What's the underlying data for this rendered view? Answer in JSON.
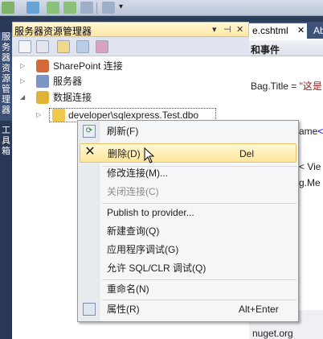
{
  "toolbar": {
    "overflow_glyph": "▾"
  },
  "left_strip": {
    "tab1": "服务器资源管理器",
    "tab2": "工具箱"
  },
  "panel": {
    "title": "服务器资源管理器",
    "pin_glyph": "▾",
    "autohide_glyph": "⊣",
    "close_glyph": "✕",
    "tree": [
      {
        "label": "SharePoint 连接",
        "icon": "sharepoint-icon"
      },
      {
        "label": "服务器",
        "icon": "server-icon"
      },
      {
        "label": "数据连接",
        "icon": "database-icon"
      },
      {
        "label": "developer\\sqlexpress.Test.dbo",
        "icon": "data-connection-icon"
      }
    ]
  },
  "editor": {
    "tab_active": "e.cshtml",
    "tab_close": "✕",
    "tab_next": "Ab",
    "header_text": "和事件",
    "code_lines": [
      {
        "pre": "Bag.Title = ",
        "str": "\"这是"
      },
      {
        "pre": "ame",
        "str": "<"
      },
      {
        "pre": "< Vie",
        "str": ""
      },
      {
        "pre": "g.Me",
        "str": ""
      }
    ],
    "footer_text": "nuget.org"
  },
  "context_menu": {
    "items": [
      {
        "label": "刷新(F)",
        "shortcut": "",
        "icon": "refresh-icon",
        "state": "normal"
      },
      {
        "label": "删除(D)",
        "shortcut": "Del",
        "icon": "delete-icon",
        "state": "highlight"
      },
      {
        "label": "修改连接(M)...",
        "shortcut": "",
        "icon": "",
        "state": "normal"
      },
      {
        "label": "关闭连接(C)",
        "shortcut": "",
        "icon": "",
        "state": "disabled"
      },
      {
        "label": "Publish to provider...",
        "shortcut": "",
        "icon": "",
        "state": "normal"
      },
      {
        "label": "新建查询(Q)",
        "shortcut": "",
        "icon": "",
        "state": "normal"
      },
      {
        "label": "应用程序调试(G)",
        "shortcut": "",
        "icon": "",
        "state": "normal"
      },
      {
        "label": "允许 SQL/CLR 调试(Q)",
        "shortcut": "",
        "icon": "",
        "state": "normal"
      },
      {
        "label": "重命名(N)",
        "shortcut": "",
        "icon": "",
        "state": "normal"
      },
      {
        "label": "属性(R)",
        "shortcut": "Alt+Enter",
        "icon": "properties-icon",
        "state": "normal"
      }
    ]
  },
  "colors": {
    "highlight_border": "#e5c365",
    "disabled_text": "#8d8d8d",
    "string_red": "#a31515",
    "tag_blue": "#0000ff"
  }
}
